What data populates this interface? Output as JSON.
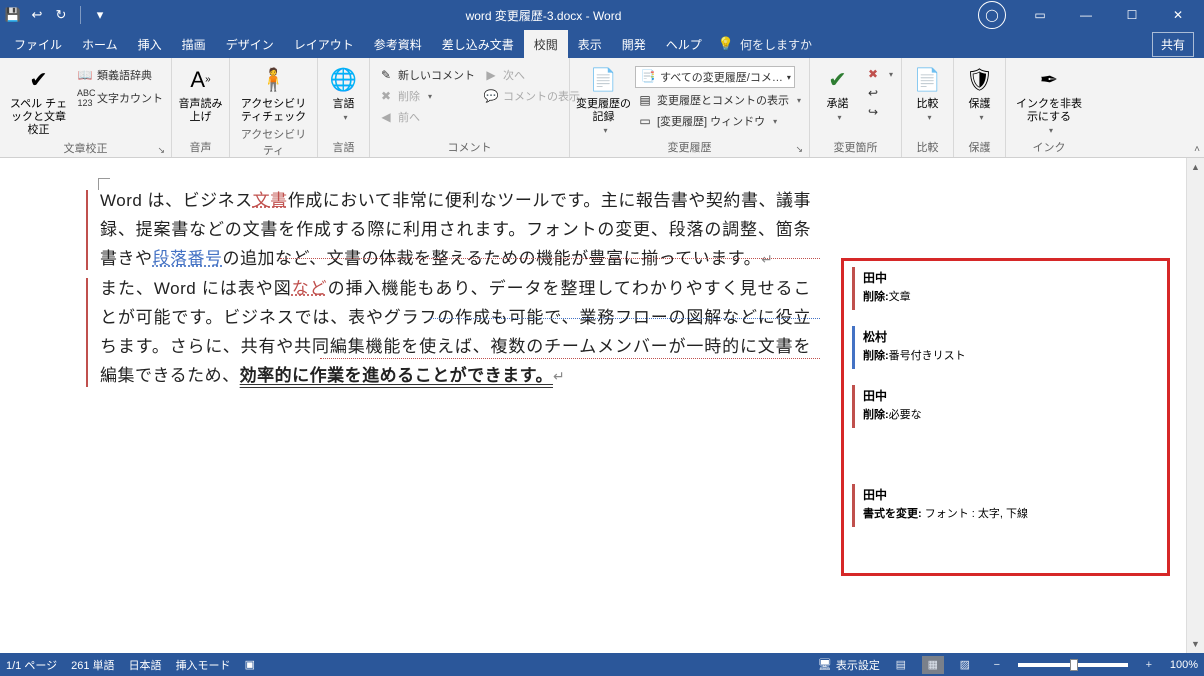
{
  "title": "word 変更履歴-3.docx  -  Word",
  "menutabs": [
    "ファイル",
    "ホーム",
    "挿入",
    "描画",
    "デザイン",
    "レイアウト",
    "参考資料",
    "差し込み文書",
    "校閲",
    "表示",
    "開発",
    "ヘルプ"
  ],
  "active_tab_index": 8,
  "tell_me_placeholder": "何をしますか",
  "share_label": "共有",
  "ribbon": {
    "proofing": {
      "spell": "スペル チェックと文章校正",
      "thesaurus": "類義語辞典",
      "wordcount": "文字カウント",
      "label": "文章校正"
    },
    "speech": {
      "readaloud": "音声読み上げ",
      "label": "音声"
    },
    "accessibility": {
      "check": "アクセシビリティチェック",
      "label": "アクセシビリティ"
    },
    "language": {
      "btn": "言語",
      "label": "言語"
    },
    "comments": {
      "new": "新しいコメント",
      "delete": "削除",
      "prev": "前へ",
      "next": "次へ",
      "show": "コメントの表示",
      "label": "コメント"
    },
    "tracking": {
      "track": "変更履歴の記録",
      "display_for_review": "すべての変更履歴/コメ…",
      "show_markup": "変更履歴とコメントの表示",
      "reviewing_pane": "[変更履歴] ウィンドウ",
      "label": "変更履歴"
    },
    "changes": {
      "accept": "承諾",
      "reject_ico": "✖",
      "prev_ico": "↩",
      "next_ico": "↪",
      "label": "変更箇所"
    },
    "compare": {
      "btn": "比較",
      "label": "比較"
    },
    "protect": {
      "btn": "保護",
      "label": "保護"
    },
    "ink": {
      "btn": "インクを非表示にする",
      "label": "インク"
    }
  },
  "document": {
    "para1_pre": "Word は、ビジネス",
    "para1_ins1": "文書",
    "para1_mid1": "作成において非常に便利なツールです。主に報告書や契約書、議事録、提案書などの文書を作成する際に利用されます。フォントの変更、段落の調整、箇条書きや",
    "para1_ins2": "段落番号",
    "para1_post": "の追加など、文書の体裁を整えるための機能が豊富に揃っています。",
    "para2_pre": "また、Word には表や図",
    "para2_ins1": "など",
    "para2_mid1": "の挿入機能もあり、データを整理してわかりやすく見せることが可能です。ビジネスでは、表やグラフの作成も可能で、業務フローの図解などに役立ちます。さらに、共有や共同編集機能を使えば、複数のチームメンバーが一時的に文書を編集できるため、",
    "para2_fmt": "効率的に作業を進めることができます。",
    "pilcrow": "↵"
  },
  "revisions": [
    {
      "author": "田中",
      "action_label": "削除:",
      "action_text": "文章",
      "cls": "rev-tanaka"
    },
    {
      "author": "松村",
      "action_label": "削除:",
      "action_text": "番号付きリスト",
      "cls": "rev-matsu"
    },
    {
      "author": "田中",
      "action_label": "削除:",
      "action_text": "必要な",
      "cls": "rev-tanaka"
    },
    {
      "author": "田中",
      "action_label": "書式を変更:",
      "action_text": " フォント : 太字, 下線",
      "cls": "rev-tanaka"
    }
  ],
  "status": {
    "page": "1/1 ページ",
    "words": "261 単語",
    "lang": "日本語",
    "insert_mode": "挿入モード",
    "display_settings": "表示設定",
    "zoom": "100%"
  }
}
